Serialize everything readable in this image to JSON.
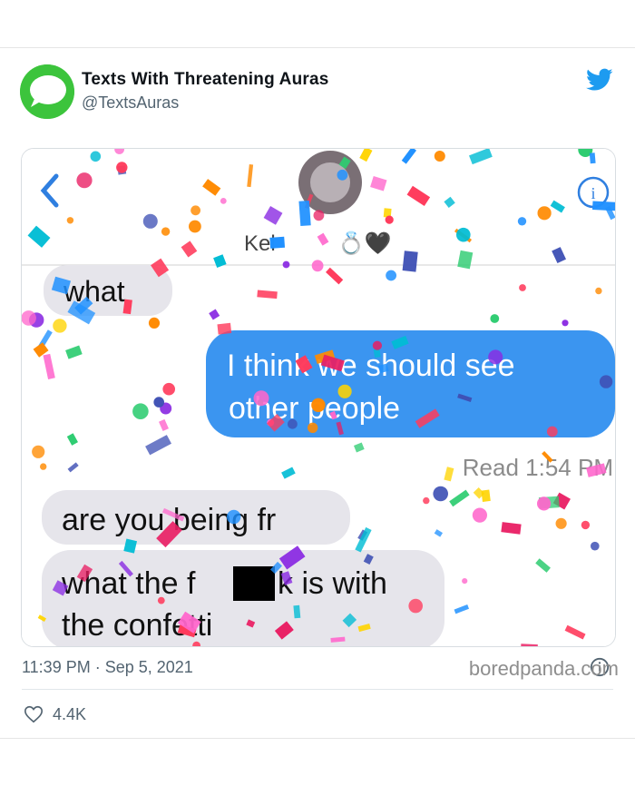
{
  "tweet": {
    "account_name": "Texts With Threatening Auras",
    "handle": "@TextsAuras",
    "timestamp": "11:39 PM · Sep 5, 2021",
    "likes": "4.4K"
  },
  "screenshot": {
    "contact_name": "Kel",
    "contact_emoji": "💍🖤",
    "received_1": "what",
    "sent_1_line1": "I think we should see",
    "sent_1_line2": "other people",
    "read_receipt": "Read 1:54 PM",
    "received_2": "are you being fr",
    "received_3_pre": "what the f",
    "received_3_post": "k is with",
    "received_3_line2": "the confetti"
  },
  "watermark": "boredpanda.com",
  "colors": {
    "accent_twitter": "#1d9bf0",
    "imessage_blue": "#3b95f0",
    "received_gray": "#e6e5eb",
    "avatar_green": "#3cc43c"
  },
  "icons": [
    "message-bubble-icon",
    "twitter-bird-icon",
    "back-chevron-icon",
    "info-icon",
    "heart-icon"
  ]
}
